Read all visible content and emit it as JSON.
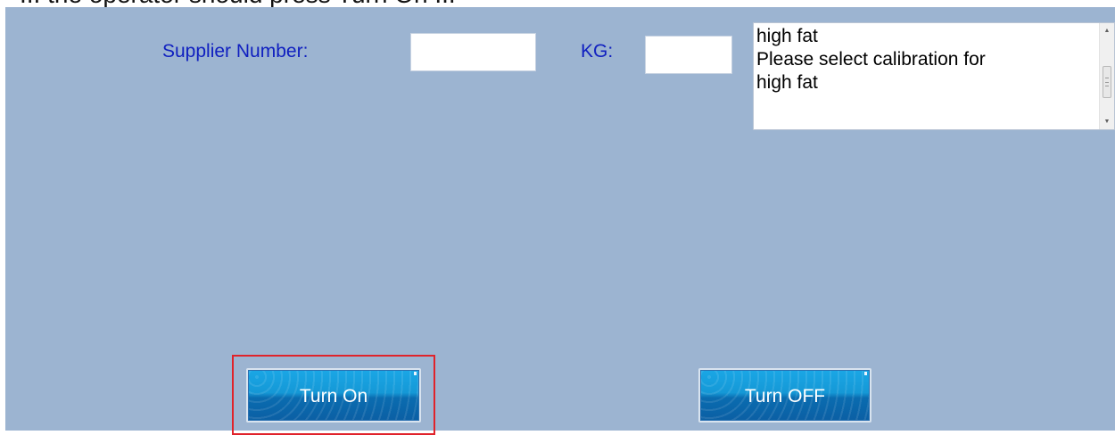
{
  "header": {
    "partial_title": "... the operator should press Turn On ..."
  },
  "form": {
    "supplier_label": "Supplier Number:",
    "supplier_value": "",
    "kg_label": "KG:",
    "kg_value": ""
  },
  "message_box": {
    "lines": [
      "high fat",
      "Please select calibration for",
      "high fat"
    ]
  },
  "buttons": {
    "turn_on": "Turn On",
    "turn_off": "Turn OFF"
  },
  "colors": {
    "panel_bg": "#9cb4d1",
    "label_text": "#1020c0",
    "button_blue": "#1598d6",
    "focus_red": "#e0232b"
  }
}
